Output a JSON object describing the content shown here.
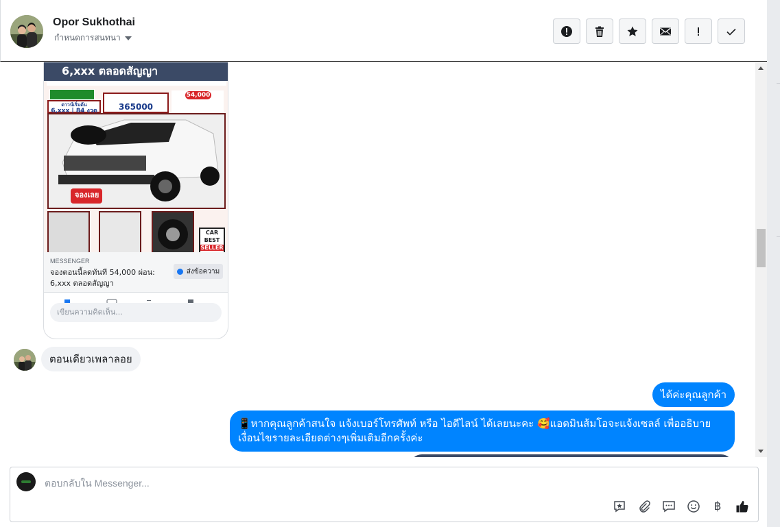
{
  "header": {
    "contact_name": "Opor Sukhothai",
    "assign_label": "กำหนดการสนทนา",
    "tools": [
      {
        "name": "alert-icon"
      },
      {
        "name": "trash-icon"
      },
      {
        "name": "star-icon"
      },
      {
        "name": "envelope-icon"
      },
      {
        "name": "exclamation-icon"
      },
      {
        "name": "check-icon"
      }
    ]
  },
  "post": {
    "ad_top_text": "6,xxx ตลอดสัญญา",
    "ad_box_down": "ดาวน์เริ่มต้น",
    "ad_box_monthly": "6,xxx | 84 งวด",
    "ad_box_price": "365000",
    "ad_box_pill": "54,000",
    "ad_badge": "จองเลย",
    "ad_seller_1": "CAR",
    "ad_seller_2": "BEST",
    "ad_seller_3": "SELLER",
    "source": "MESSENGER",
    "text": "จองตอนนี้ลดทันที 54,000 ผ่อน: 6,xxx ตลอดสัญญา",
    "send_button": "ส่งข้อความ",
    "comment_placeholder": "เขียนความคิดเห็น..."
  },
  "messages": {
    "incoming_1": "ตอนเดียวเพลาลอย",
    "outgoing_1": "ได้ค่ะคุณลูกค้า",
    "outgoing_2": "📱หากคุณลูกค้าสนใจ แจ้งเบอร์โทรศัพท์ หรือ ไอดีไลน์  ได้เลยนะคะ 🥰แอดมินส้มโอจะแจ้งเซลล์   เพื่ออธิบายเงื่อนไขรายละเอียดต่างๆเพิ่มเติมอีกครั้งค่ะ"
  },
  "composer": {
    "placeholder": "ตอบกลับใน Messenger...",
    "icons": [
      "feedback-icon",
      "attachment-icon",
      "saved-replies-icon",
      "emoji-icon",
      "baht-icon",
      "thumbs-up-icon"
    ],
    "baht_symbol": "฿"
  },
  "colors": {
    "messenger_blue": "#0084ff",
    "bubble_gray": "#f0f2f5",
    "ad_navy": "#3b4a66"
  }
}
